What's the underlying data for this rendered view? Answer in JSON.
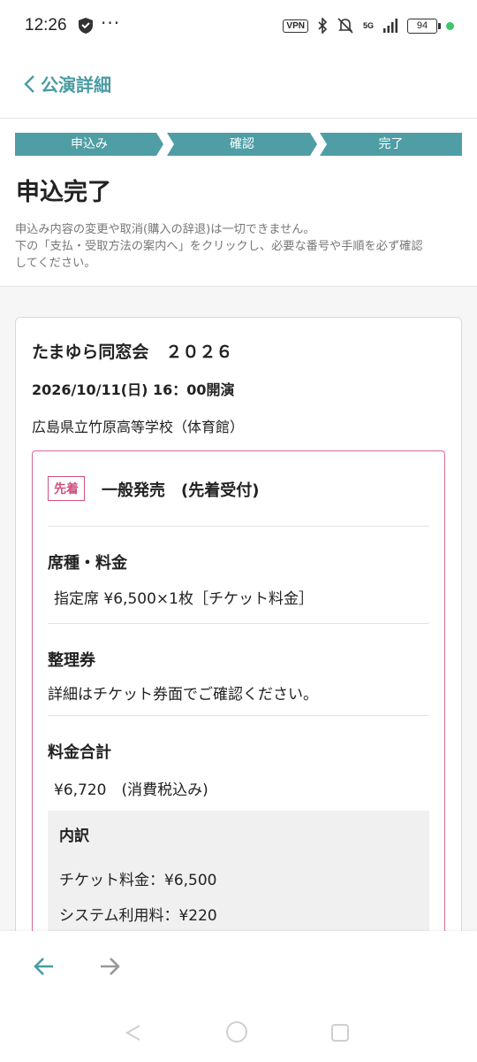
{
  "status_bar": {
    "time": "12:26",
    "dots": "···",
    "vpn": "VPN",
    "network": "5G",
    "battery": "94"
  },
  "header": {
    "back_label": "公演詳細",
    "accent_color": "#4a9ba3"
  },
  "steps": [
    "申込み",
    "確認",
    "完了"
  ],
  "page_title": "申込完了",
  "notice": [
    "申込み内容の変更や取消(購入の辞退)は一切できません。",
    "下の「支払・受取方法の案内へ」をクリックし、必要な番号や手順を必ず確認",
    "してください。"
  ],
  "event": {
    "title": "たまゆら同窓会　２０２６",
    "date": "2026/10/11(日) 16：00開演",
    "venue": "広島県立竹原高等学校（体育館）"
  },
  "ticket": {
    "badge": "先着",
    "sale_type": "一般発売　(先着受付)",
    "seat_label": "席種・料金",
    "seat_value": "指定席 ¥6,500×1枚［チケット料金］",
    "number_label": "整理券",
    "number_value": "詳細はチケット券面でご確認ください。",
    "total_label": "料金合計",
    "total_value": "¥6,720　(消費税込み)",
    "breakdown_title": "内訳",
    "breakdown": [
      "チケット料金：¥6,500",
      "システム利用料：¥220"
    ],
    "badge_color": "#d0507e"
  }
}
